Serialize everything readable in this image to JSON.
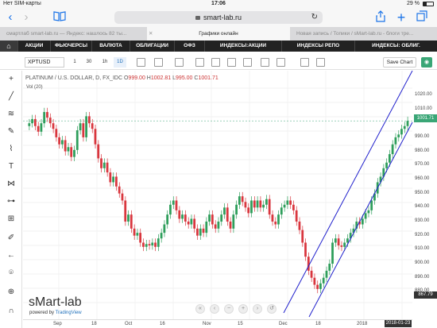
{
  "status_bar": {
    "carrier": "Нет SIM-карты",
    "time": "17:06",
    "battery": "29 %"
  },
  "browser": {
    "url": "smart-lab.ru",
    "tabs": [
      "смартлаб smart-lab.ru — Яндекс: нашлось 82 ты...",
      "Графики онлайн",
      "Новая запись / Топики / sMart-lab.ru - блоги тре..."
    ]
  },
  "site_nav": {
    "items": [
      "АКЦИИ",
      "ФЬЮЧЕРСЫ",
      "ВАЛЮТА",
      "ОБЛИГАЦИИ",
      "ОФЗ",
      "ИНДЕКСЫ:АКЦИИ",
      "ИНДЕКСЫ РЕПО",
      "ИНДЕКСЫ: ОБЛИГ."
    ]
  },
  "chart_toolbar": {
    "symbol": "XPTUSD",
    "timeframes": [
      "1",
      "30",
      "1h",
      "1D"
    ],
    "selected_timeframe": "1D",
    "save_label": "Save Chart"
  },
  "legend": {
    "title": "PLATINUM / U.S. DOLLAR, D, FX_IDC",
    "o_label": "O",
    "o": "999.00",
    "h_label": "H",
    "h": "1002.81",
    "l_label": "L",
    "l": "995.00",
    "c_label": "C",
    "c": "1001.71",
    "volume": "Vol (20)"
  },
  "price_axis": {
    "ticks": [
      "1020.00",
      "1010.00",
      "1001.71",
      "990.00",
      "980.00",
      "970.00",
      "960.00",
      "950.00",
      "940.00",
      "930.00",
      "920.00",
      "910.00",
      "900.00",
      "890.00",
      "880.00",
      "867.79"
    ],
    "last_price": "1001.71",
    "low_label": "867.79"
  },
  "time_axis": {
    "ticks": [
      "Sep",
      "18",
      "Oct",
      "16",
      "Nov",
      "15",
      "Dec",
      "18",
      "2018",
      "18"
    ],
    "cursor_date": "2018-01-23"
  },
  "branding": {
    "watermark": "sMart-lab",
    "powered_prefix": "powered by",
    "powered_name": "TradingView"
  },
  "colors": {
    "up": "#2e9e5b",
    "down": "#d9363e",
    "channel": "#1f1fcc",
    "accent": "#1e6fba"
  },
  "chart_data": {
    "type": "candlestick",
    "title": "PLATINUM / U.S. DOLLAR, D, FX_IDC",
    "ylim": [
      867.79,
      1025
    ],
    "x_ticks": [
      "Sep",
      "18",
      "Oct",
      "16",
      "Nov",
      "15",
      "Dec",
      "18",
      "2018",
      "18"
    ],
    "close": [
      1000,
      1003,
      998,
      994,
      1000,
      1008,
      1004,
      1000,
      996,
      990,
      985,
      988,
      980,
      983,
      976,
      981,
      995,
      1000,
      990,
      1005,
      1000,
      996,
      985,
      975,
      968,
      972,
      965,
      958,
      962,
      955,
      950,
      945,
      930,
      935,
      925,
      920,
      922,
      915,
      912,
      914,
      913,
      915,
      912,
      918,
      922,
      928,
      935,
      942,
      945,
      938,
      932,
      935,
      930,
      928,
      932,
      925,
      920,
      925,
      922,
      930,
      935,
      928,
      925,
      930,
      935,
      940,
      930,
      925,
      935,
      942,
      948,
      944,
      940,
      936,
      945,
      940,
      945,
      940,
      942,
      946,
      935,
      930,
      928,
      935,
      940,
      942,
      945,
      942,
      938,
      930,
      924,
      915,
      905,
      895,
      890,
      885,
      882,
      886,
      890,
      895,
      900,
      915,
      918,
      913,
      912,
      915,
      918,
      922,
      925,
      930,
      928,
      932,
      936,
      938,
      945,
      950,
      958,
      962,
      968,
      972,
      978,
      985,
      990,
      992,
      996,
      998,
      1001.71
    ]
  }
}
